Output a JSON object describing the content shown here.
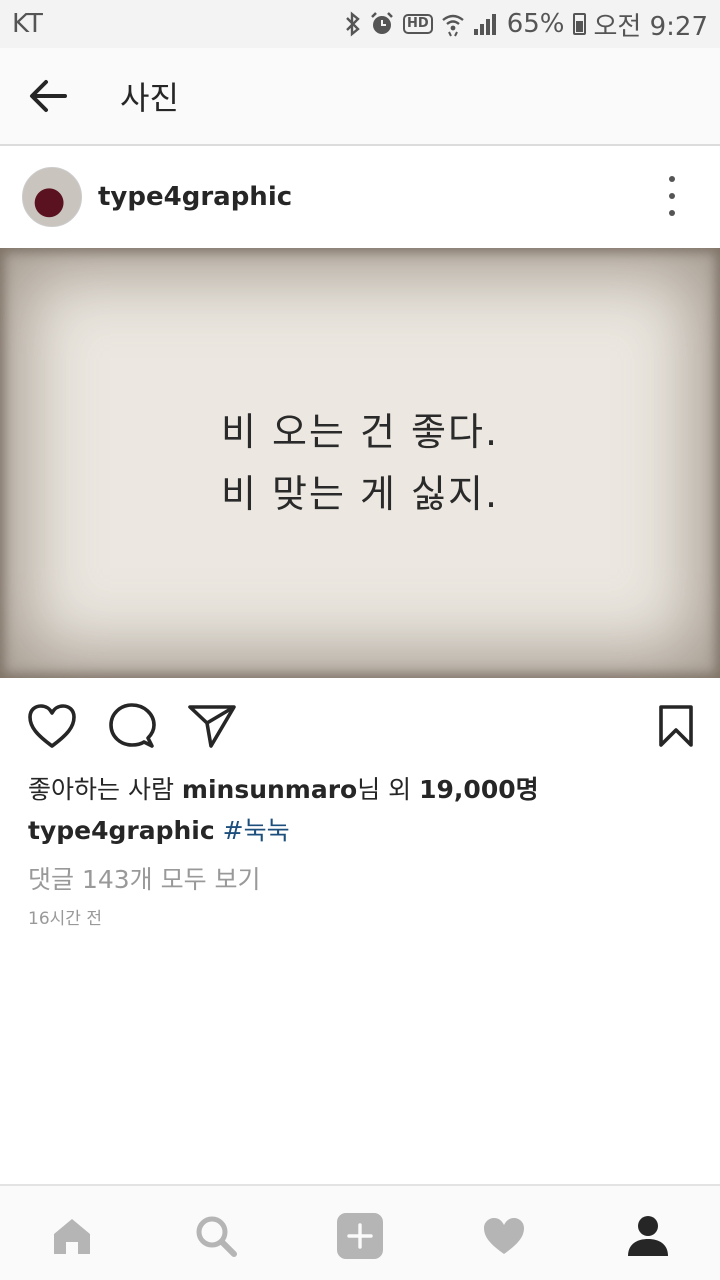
{
  "status_bar": {
    "carrier": "KT",
    "battery": "65%",
    "time": "오전 9:27",
    "hd_label": "HD",
    "icons": [
      "bluetooth-icon",
      "alarm-icon",
      "hd-icon",
      "wifi-icon",
      "signal-icon",
      "battery-icon"
    ]
  },
  "header": {
    "title": "사진"
  },
  "post": {
    "username": "type4graphic",
    "image_text": [
      "비 오는 건 좋다.",
      "비 맞는 게 싫지."
    ],
    "likes": {
      "prefix": "좋아하는 사람 ",
      "liker": "minsunmaro",
      "middle": "님 외 ",
      "count": "19,000명"
    },
    "caption_user": "type4graphic",
    "caption_tag": "#눅눅",
    "comments_link": "댓글 143개 모두 보기",
    "timestamp": "16시간 전"
  },
  "nav": {
    "items": [
      "home-icon",
      "search-icon",
      "add-icon",
      "heart-icon",
      "profile-icon"
    ]
  },
  "colors": {
    "text": "#262626",
    "muted": "#999999",
    "hashtag": "#1d4f7d",
    "nav_inactive": "#b5b5b5",
    "nav_active": "#262626"
  }
}
